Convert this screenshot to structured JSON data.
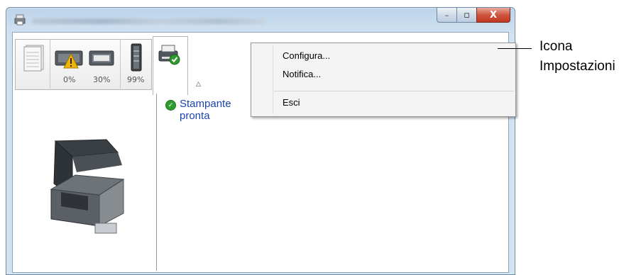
{
  "window": {
    "controls": {
      "minimize": "–",
      "maximize": "▫",
      "close": "X"
    }
  },
  "toolbar": {
    "tabs": [
      {
        "name": "pages",
        "icon": "document-stack-icon"
      },
      {
        "name": "toner-warning",
        "icon": "toner-warning-icon",
        "value": "0%"
      },
      {
        "name": "toner",
        "icon": "toner-icon",
        "value": "30%"
      },
      {
        "name": "paper",
        "icon": "paper-level-icon",
        "value": "99%"
      }
    ],
    "active_tab_icon": "printer-ok-icon",
    "collapse_icon": "chevron-up-icon",
    "settings_icon": "gear-icon"
  },
  "status": {
    "icon": "check-icon",
    "text": "Stampante pronta"
  },
  "menu": {
    "items": [
      {
        "label": "Configura..."
      },
      {
        "label": "Notifica..."
      },
      {
        "label": "Esci"
      }
    ]
  },
  "callout": {
    "line1": "Icona",
    "line2": "Impostazioni"
  },
  "colors": {
    "status_text": "#1a44b0",
    "ok_green": "#2f9c2f",
    "warning": "#f2b400"
  }
}
